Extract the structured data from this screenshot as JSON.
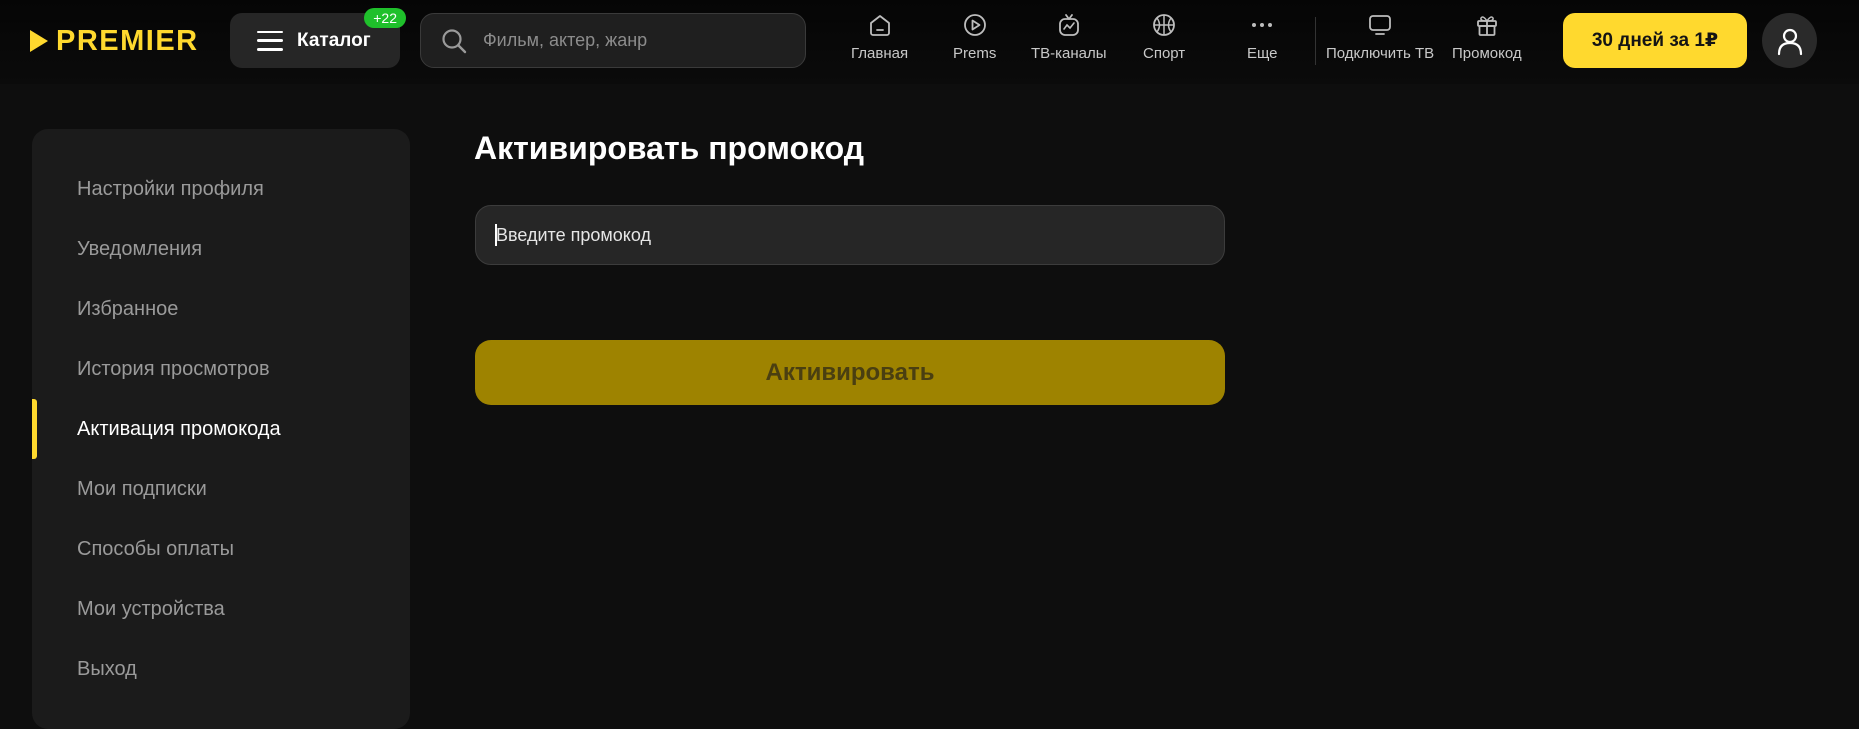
{
  "brand": {
    "name": "PREMIER",
    "color": "#ffd92e"
  },
  "header": {
    "catalog": {
      "label": "Каталог",
      "badge": "+22"
    },
    "search": {
      "placeholder": "Фильм, актер, жанр",
      "value": ""
    },
    "nav": [
      {
        "label": "Главная",
        "icon": "home-icon"
      },
      {
        "label": "Prems",
        "icon": "play-icon"
      },
      {
        "label": "ТВ-каналы",
        "icon": "tv-channels-icon"
      },
      {
        "label": "Спорт",
        "icon": "basketball-icon"
      },
      {
        "label": "Еще",
        "icon": "more-icon"
      },
      {
        "label": "Подключить ТВ",
        "icon": "connect-tv-icon"
      },
      {
        "label": "Промокод",
        "icon": "gift-icon"
      }
    ],
    "cta": "30 дней за 1₽",
    "profile_icon": "user-icon"
  },
  "sidebar": {
    "items": [
      {
        "label": "Настройки профиля",
        "active": false
      },
      {
        "label": "Уведомления",
        "active": false
      },
      {
        "label": "Избранное",
        "active": false
      },
      {
        "label": "История просмотров",
        "active": false
      },
      {
        "label": "Активация промокода",
        "active": true
      },
      {
        "label": "Мои подписки",
        "active": false
      },
      {
        "label": "Способы оплаты",
        "active": false
      },
      {
        "label": "Мои устройства",
        "active": false
      },
      {
        "label": "Выход",
        "active": false
      }
    ]
  },
  "main": {
    "title": "Активировать промокод",
    "promo_input": {
      "placeholder": "Введите промокод",
      "value": ""
    },
    "activate_button": "Активировать",
    "activate_disabled": true
  },
  "colors": {
    "accent": "#ffd92e",
    "badge": "#1fc02b",
    "button_disabled": "#9e8300",
    "background": "#0e0e0e",
    "panel": "#1b1b1b"
  }
}
